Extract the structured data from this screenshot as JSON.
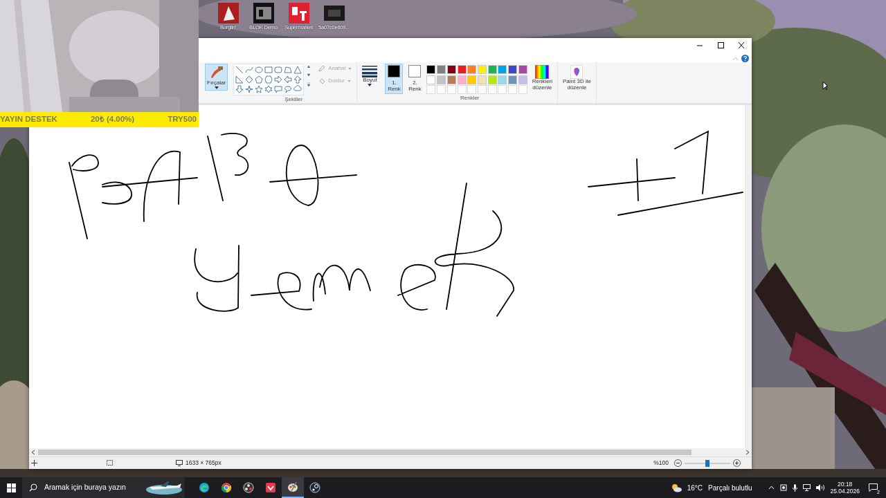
{
  "desktop_icons": [
    {
      "label": "Burglin'",
      "kind": "gnome"
    },
    {
      "label": "BLOK Demo",
      "kind": "blok"
    },
    {
      "label": "Supermarket",
      "kind": "st"
    },
    {
      "label": "5a07c0e609...",
      "kind": "dark"
    }
  ],
  "stream_overlay": {
    "label": "YAYIN DESTEK",
    "amount": "20₺ (4.00%)",
    "goal": "TRY500"
  },
  "paint": {
    "ribbon": {
      "brushes": {
        "label": "Fırçalar",
        "selected": true
      },
      "shapes_group": "Şekiller",
      "outline": "Anahat",
      "fill": "Doldur",
      "size": "Boyut",
      "colors": [
        {
          "line1": "1.",
          "line2": "Renk",
          "color": "#000000",
          "selected": true
        },
        {
          "line1": "2.",
          "line2": "Renk",
          "color": "#ffffff",
          "selected": false
        }
      ],
      "palette": [
        {
          "color": "#000000"
        },
        {
          "color": "#7f7f7f"
        },
        {
          "color": "#880015"
        },
        {
          "color": "#ed1c24"
        },
        {
          "color": "#ff7f27"
        },
        {
          "color": "#fff200"
        },
        {
          "color": "#22b14c"
        },
        {
          "color": "#00a2e8"
        },
        {
          "color": "#3f48cc"
        },
        {
          "color": "#a349a4"
        },
        {
          "color": "#ffffff"
        },
        {
          "color": "#c3c3c3"
        },
        {
          "color": "#b97a57"
        },
        {
          "color": "#ffaec9"
        },
        {
          "color": "#ffc90e"
        },
        {
          "color": "#efe4b0"
        },
        {
          "color": "#b5e61d"
        },
        {
          "color": "#99d9ea"
        },
        {
          "color": "#7092be"
        },
        {
          "color": "#c8bfe7"
        }
      ],
      "edit_colors": [
        "Renkleri",
        "düzenle"
      ],
      "paint3d": [
        "Paint 3D ile",
        "düzenle"
      ],
      "colors_group": "Renkler"
    },
    "status_bar": {
      "canvas_size": "1633 × 765px",
      "zoom": "%100",
      "zoom_slider": {
        "level": 0.5
      }
    }
  },
  "taskbar": {
    "search": {
      "placeholder": "Aramak için buraya yazın"
    },
    "apps": [
      {
        "kind": "edge",
        "selected": false
      },
      {
        "kind": "chrome",
        "selected": false
      },
      {
        "kind": "obs",
        "selected": false
      },
      {
        "kind": "pocket",
        "selected": false
      },
      {
        "kind": "paint",
        "selected": true
      },
      {
        "kind": "steam",
        "selected": false
      }
    ],
    "weather": {
      "temp": "16°C",
      "text": "Parçalı bulutlu"
    },
    "time": "20:18",
    "date": "25.04.2026",
    "notifications": "2"
  }
}
